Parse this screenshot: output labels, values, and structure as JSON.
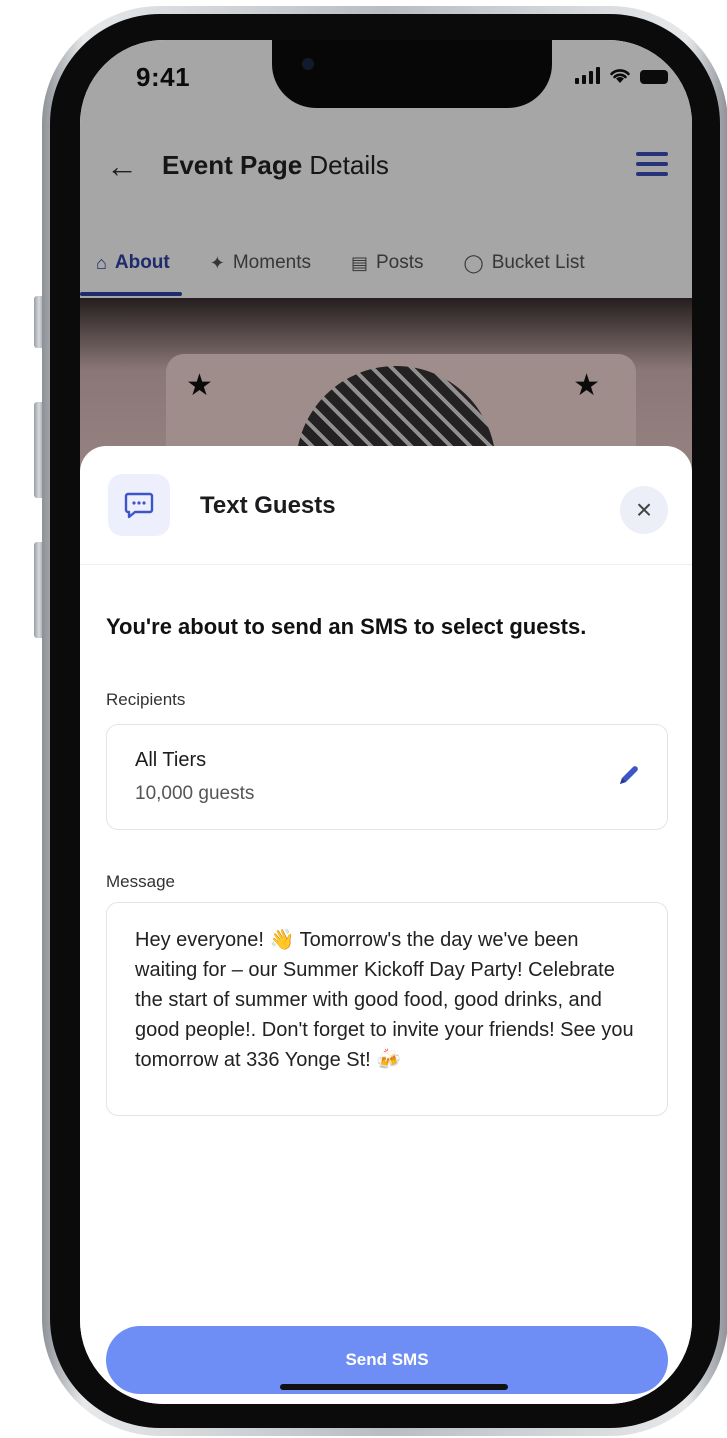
{
  "status_bar": {
    "time": "9:41"
  },
  "header": {
    "title_bold": "Event Page",
    "title_rest": "Details"
  },
  "tabs": [
    {
      "label": "About",
      "icon": "home-icon",
      "active": true
    },
    {
      "label": "Moments",
      "icon": "sparkle-icon",
      "active": false
    },
    {
      "label": "Posts",
      "icon": "posts-icon",
      "active": false
    },
    {
      "label": "Bucket List",
      "icon": "bucket-icon",
      "active": false
    }
  ],
  "sheet": {
    "title": "Text Guests",
    "intro": "You're about to send an SMS to select guests.",
    "recipients_label": "Recipients",
    "recipients": {
      "name": "All Tiers",
      "count": "10,000 guests"
    },
    "message_label": "Message",
    "message": "Hey everyone! 👋 Tomorrow's the day we've been waiting for – our Summer Kickoff Day Party! Celebrate the start of summer with good food, good drinks, and good people!. Don't forget to invite your friends! See you tomorrow at 336 Yonge St! 🍻",
    "send_label": "Send SMS"
  },
  "colors": {
    "accent": "#2f43a8",
    "send_button": "#6f8ef5"
  }
}
